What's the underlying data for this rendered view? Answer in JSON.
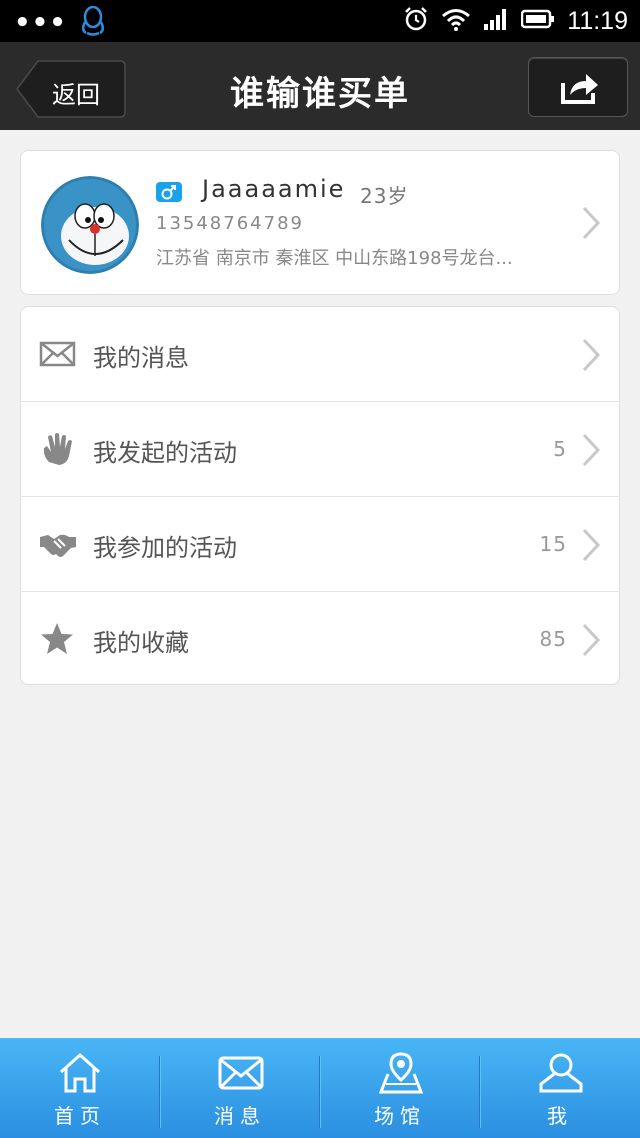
{
  "status_bar": {
    "dots": "•••",
    "time": "11:19"
  },
  "nav": {
    "back_label": "返回",
    "title": "谁输谁买单"
  },
  "profile": {
    "name": "Jaaaaamie",
    "age": "23岁",
    "phone": "13548764789",
    "address": "江苏省 南京市 秦淮区 中山东路198号龙台..."
  },
  "menu": [
    {
      "icon": "envelope-icon",
      "label": "我的消息",
      "count": ""
    },
    {
      "icon": "hand-icon",
      "label": "我发起的活动",
      "count": "5"
    },
    {
      "icon": "handshake-icon",
      "label": "我参加的活动",
      "count": "15"
    },
    {
      "icon": "star-icon",
      "label": "我的收藏",
      "count": "85"
    }
  ],
  "tabs": [
    {
      "icon": "home-icon",
      "label": "首页"
    },
    {
      "icon": "mail-icon",
      "label": "消息"
    },
    {
      "icon": "venue-map-icon",
      "label": "场馆"
    },
    {
      "icon": "user-icon",
      "label": "我"
    }
  ],
  "colors": {
    "nav_bg": "#2b2b2b",
    "accent": "#1aa3e8",
    "tab_bar": "#2a8fe0"
  }
}
